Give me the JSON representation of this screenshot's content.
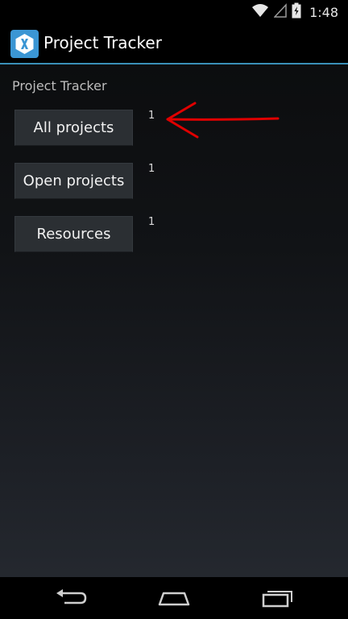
{
  "status_bar": {
    "time": "1:48",
    "icons": [
      "wifi-icon",
      "signal-icon",
      "battery-icon"
    ]
  },
  "action_bar": {
    "title": "Project Tracker",
    "icon": "xamarin-x-icon",
    "accent_color": "#3a8fb7",
    "icon_color": "#3b96d4"
  },
  "main": {
    "section_label": "Project Tracker",
    "items": [
      {
        "label": "All projects",
        "count": "1"
      },
      {
        "label": "Open projects",
        "count": "1"
      },
      {
        "label": "Resources",
        "count": "1"
      }
    ],
    "annotation": {
      "icon": "red-arrow-icon",
      "color": "#e00000"
    }
  },
  "nav_bar": {
    "buttons": [
      "back-icon",
      "home-icon",
      "recent-apps-icon"
    ]
  }
}
